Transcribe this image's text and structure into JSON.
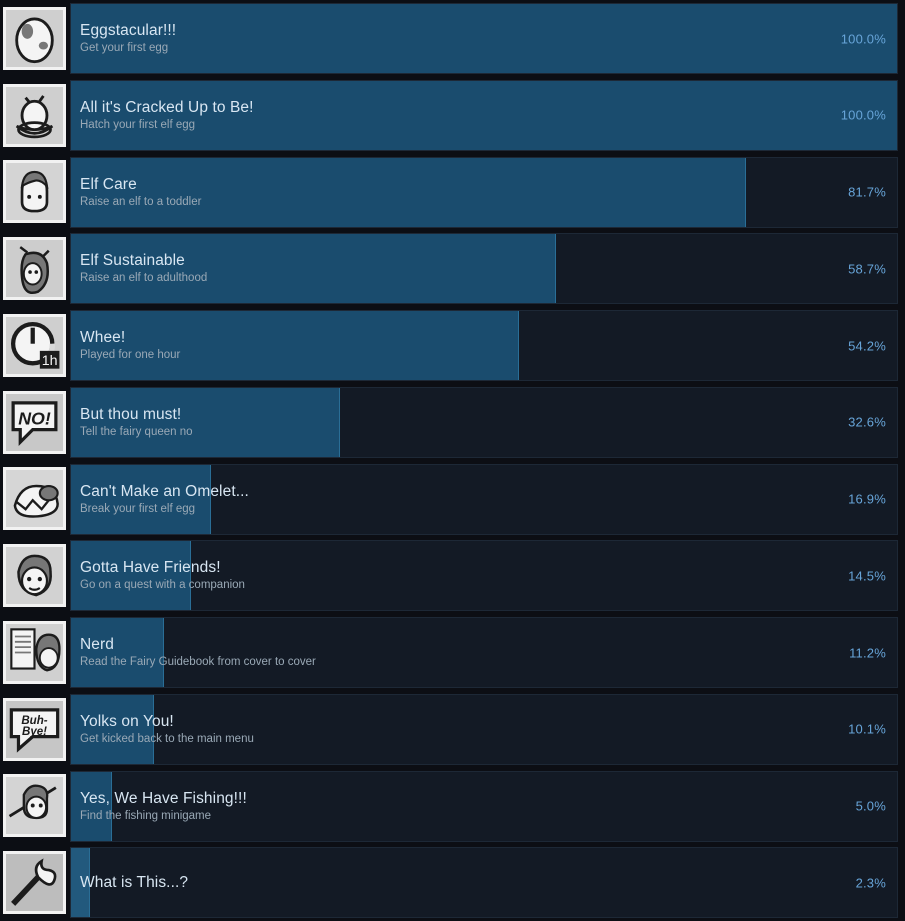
{
  "page": {
    "title": "Steam Achievements Global Stats",
    "background_color": "#0c0e14",
    "accent_color": "#1a4c6e",
    "percent_text_color": "#67a4d8",
    "title_text_color": "#d8e6f2",
    "desc_text_color": "#9aa9b6"
  },
  "achievements": [
    {
      "title": "Eggstacular!!!",
      "description": "Get your first egg",
      "percent_label": "100.0%",
      "percent_value": 100.0,
      "icon": "egg-icon"
    },
    {
      "title": "All it's Cracked Up to Be!",
      "description": "Hatch your first elf egg",
      "percent_label": "100.0%",
      "percent_value": 100.0,
      "icon": "hatching-egg-icon"
    },
    {
      "title": "Elf Care",
      "description": "Raise an elf to a toddler",
      "percent_label": "81.7%",
      "percent_value": 81.7,
      "icon": "elf-toddler-icon"
    },
    {
      "title": "Elf Sustainable",
      "description": "Raise an elf to adulthood",
      "percent_label": "58.7%",
      "percent_value": 58.7,
      "icon": "elf-adult-icon"
    },
    {
      "title": "Whee!",
      "description": "Played for one hour",
      "percent_label": "54.2%",
      "percent_value": 54.2,
      "icon": "clock-one-hour-icon"
    },
    {
      "title": "But thou must!",
      "description": "Tell the fairy queen no",
      "percent_label": "32.6%",
      "percent_value": 32.6,
      "icon": "speech-bubble-no-icon"
    },
    {
      "title": "Can't Make an Omelet...",
      "description": "Break your first elf egg",
      "percent_label": "16.9%",
      "percent_value": 16.9,
      "icon": "broken-egg-icon"
    },
    {
      "title": "Gotta Have Friends!",
      "description": "Go on a quest with a companion",
      "percent_label": "14.5%",
      "percent_value": 14.5,
      "icon": "companion-face-icon"
    },
    {
      "title": "Nerd",
      "description": "Read the Fairy Guidebook from cover to cover",
      "percent_label": "11.2%",
      "percent_value": 11.2,
      "icon": "reading-book-icon"
    },
    {
      "title": "Yolks on You!",
      "description": "Get kicked back to the main menu",
      "percent_label": "10.1%",
      "percent_value": 10.1,
      "icon": "speech-bubble-buh-bye-icon"
    },
    {
      "title": "Yes, We Have Fishing!!!",
      "description": "Find the fishing minigame",
      "percent_label": "5.0%",
      "percent_value": 5.0,
      "icon": "fishing-rod-icon"
    },
    {
      "title": "What is This...?",
      "description": "",
      "percent_label": "2.3%",
      "percent_value": 2.3,
      "icon": "mystery-torch-icon"
    }
  ]
}
